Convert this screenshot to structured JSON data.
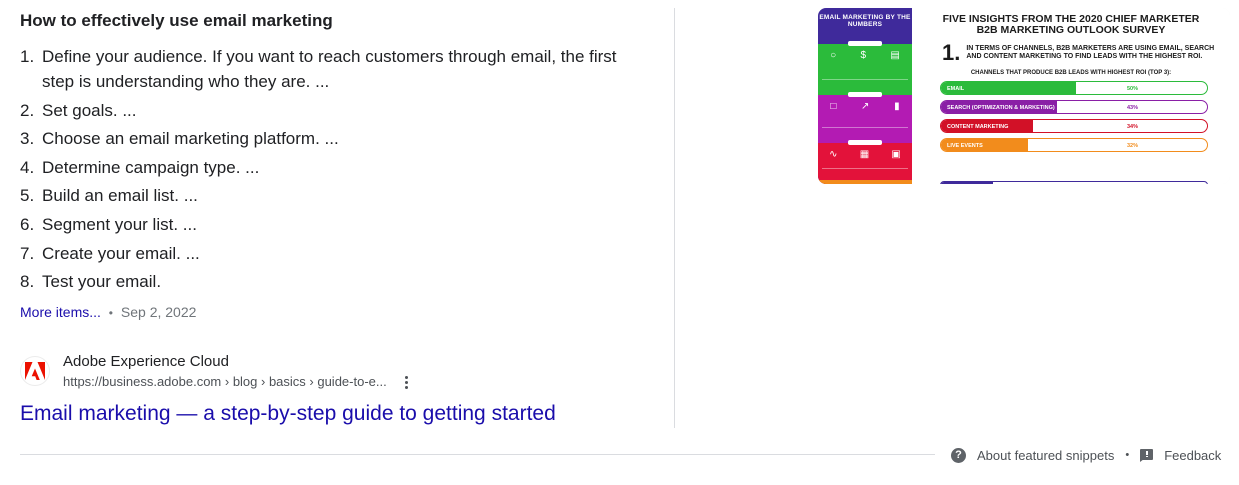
{
  "snippet": {
    "heading": "How to effectively use email marketing",
    "steps": [
      {
        "num": "1.",
        "text": "Define your audience. If you want to reach customers through email, the first step is understanding who they are. ..."
      },
      {
        "num": "2.",
        "text": "Set goals. ..."
      },
      {
        "num": "3.",
        "text": "Choose an email marketing platform. ..."
      },
      {
        "num": "4.",
        "text": "Determine campaign type. ..."
      },
      {
        "num": "5.",
        "text": "Build an email list. ..."
      },
      {
        "num": "6.",
        "text": "Segment your list. ..."
      },
      {
        "num": "7.",
        "text": "Create your email. ..."
      },
      {
        "num": "8.",
        "text": "Test your email."
      }
    ],
    "more_items": "More items...",
    "separator": "•",
    "date": "Sep 2, 2022"
  },
  "source": {
    "name": "Adobe Experience Cloud",
    "url": "https://business.adobe.com › blog › basics › guide-to-e...",
    "title": "Email marketing — a step-by-step guide to getting started",
    "favicon_icon": "adobe-logo-icon",
    "brand_color": "#eb1000"
  },
  "thumbnail": {
    "left_title": "EMAIL MARKETING BY THE NUMBERS",
    "right_title_line1": "FIVE INSIGHTS FROM THE 2020 CHIEF MARKETER",
    "right_title_line2": "B2B MARKETING OUTLOOK SURVEY",
    "point_number": "1.",
    "point_text": "IN TERMS OF CHANNELS, B2B MARKETERS ARE USING EMAIL, SEARCH AND CONTENT MARKETING TO FIND LEADS WITH THE HIGHEST ROI.",
    "subheading": "CHANNELS THAT PRODUCE B2B LEADS WITH HIGHEST ROI (TOP 3):",
    "bars": [
      {
        "label": "EMAIL",
        "value": "50%",
        "pct": 50,
        "color": "#2bbb3b"
      },
      {
        "label": "SEARCH (OPTIMIZATION & MARKETING)",
        "value": "43%",
        "pct": 43,
        "color": "#8a1fa6"
      },
      {
        "label": "CONTENT MARKETING",
        "value": "34%",
        "pct": 34,
        "color": "#d21127"
      },
      {
        "label": "LIVE EVENTS",
        "value": "32%",
        "pct": 32,
        "color": "#f28c1c"
      }
    ]
  },
  "footer": {
    "about": "About featured snippets",
    "separator": "•",
    "feedback": "Feedback",
    "help_icon": "help-circle-icon",
    "feedback_icon": "feedback-flag-icon"
  },
  "colors": {
    "link": "#1a0dab",
    "text": "#202124",
    "muted": "#70757a"
  }
}
